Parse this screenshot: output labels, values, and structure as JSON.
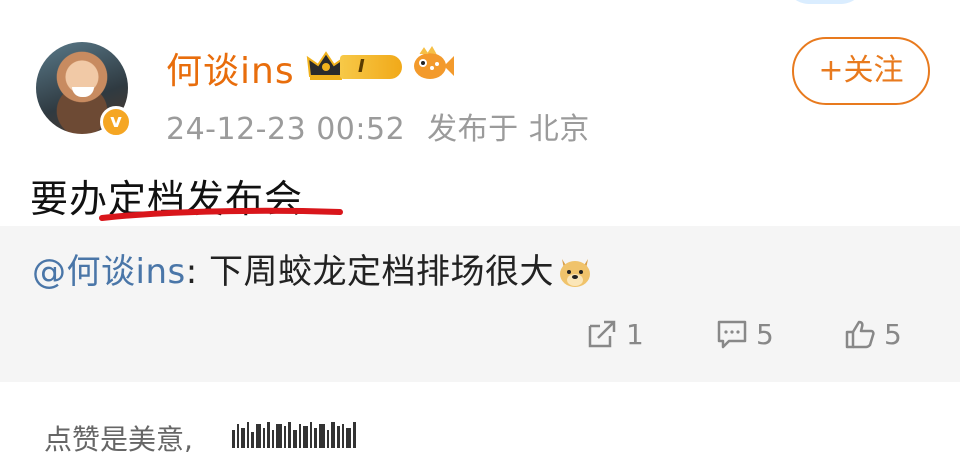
{
  "post": {
    "username": "何谈ins",
    "level_badge": "I",
    "timestamp": "24-12-23 00:52",
    "location_prefix": "发布于",
    "location": "北京",
    "follow_label": "+关注",
    "text": "要办定档发布会"
  },
  "quote": {
    "mention": "@何谈ins",
    "separator": ": ",
    "text": "下周蛟龙定档排场很大",
    "repost_count": "1",
    "comment_count": "5",
    "like_count": "5"
  },
  "footer": {
    "text": "点赞是美意,"
  },
  "icons": {
    "avatar": "avatar",
    "verified": "verified-badge-icon",
    "crown": "crown-icon",
    "fish": "fish-icon",
    "doge": "doge-emoji-icon",
    "repost": "repost-icon",
    "comment": "comment-icon",
    "like": "thumbs-up-icon"
  },
  "colors": {
    "username": "#e86d0c",
    "accent": "#e87a1e",
    "mention": "#4a76a8",
    "underline": "#d9161b",
    "quote_bg": "#f5f5f5",
    "meta": "#9b9b9b"
  }
}
